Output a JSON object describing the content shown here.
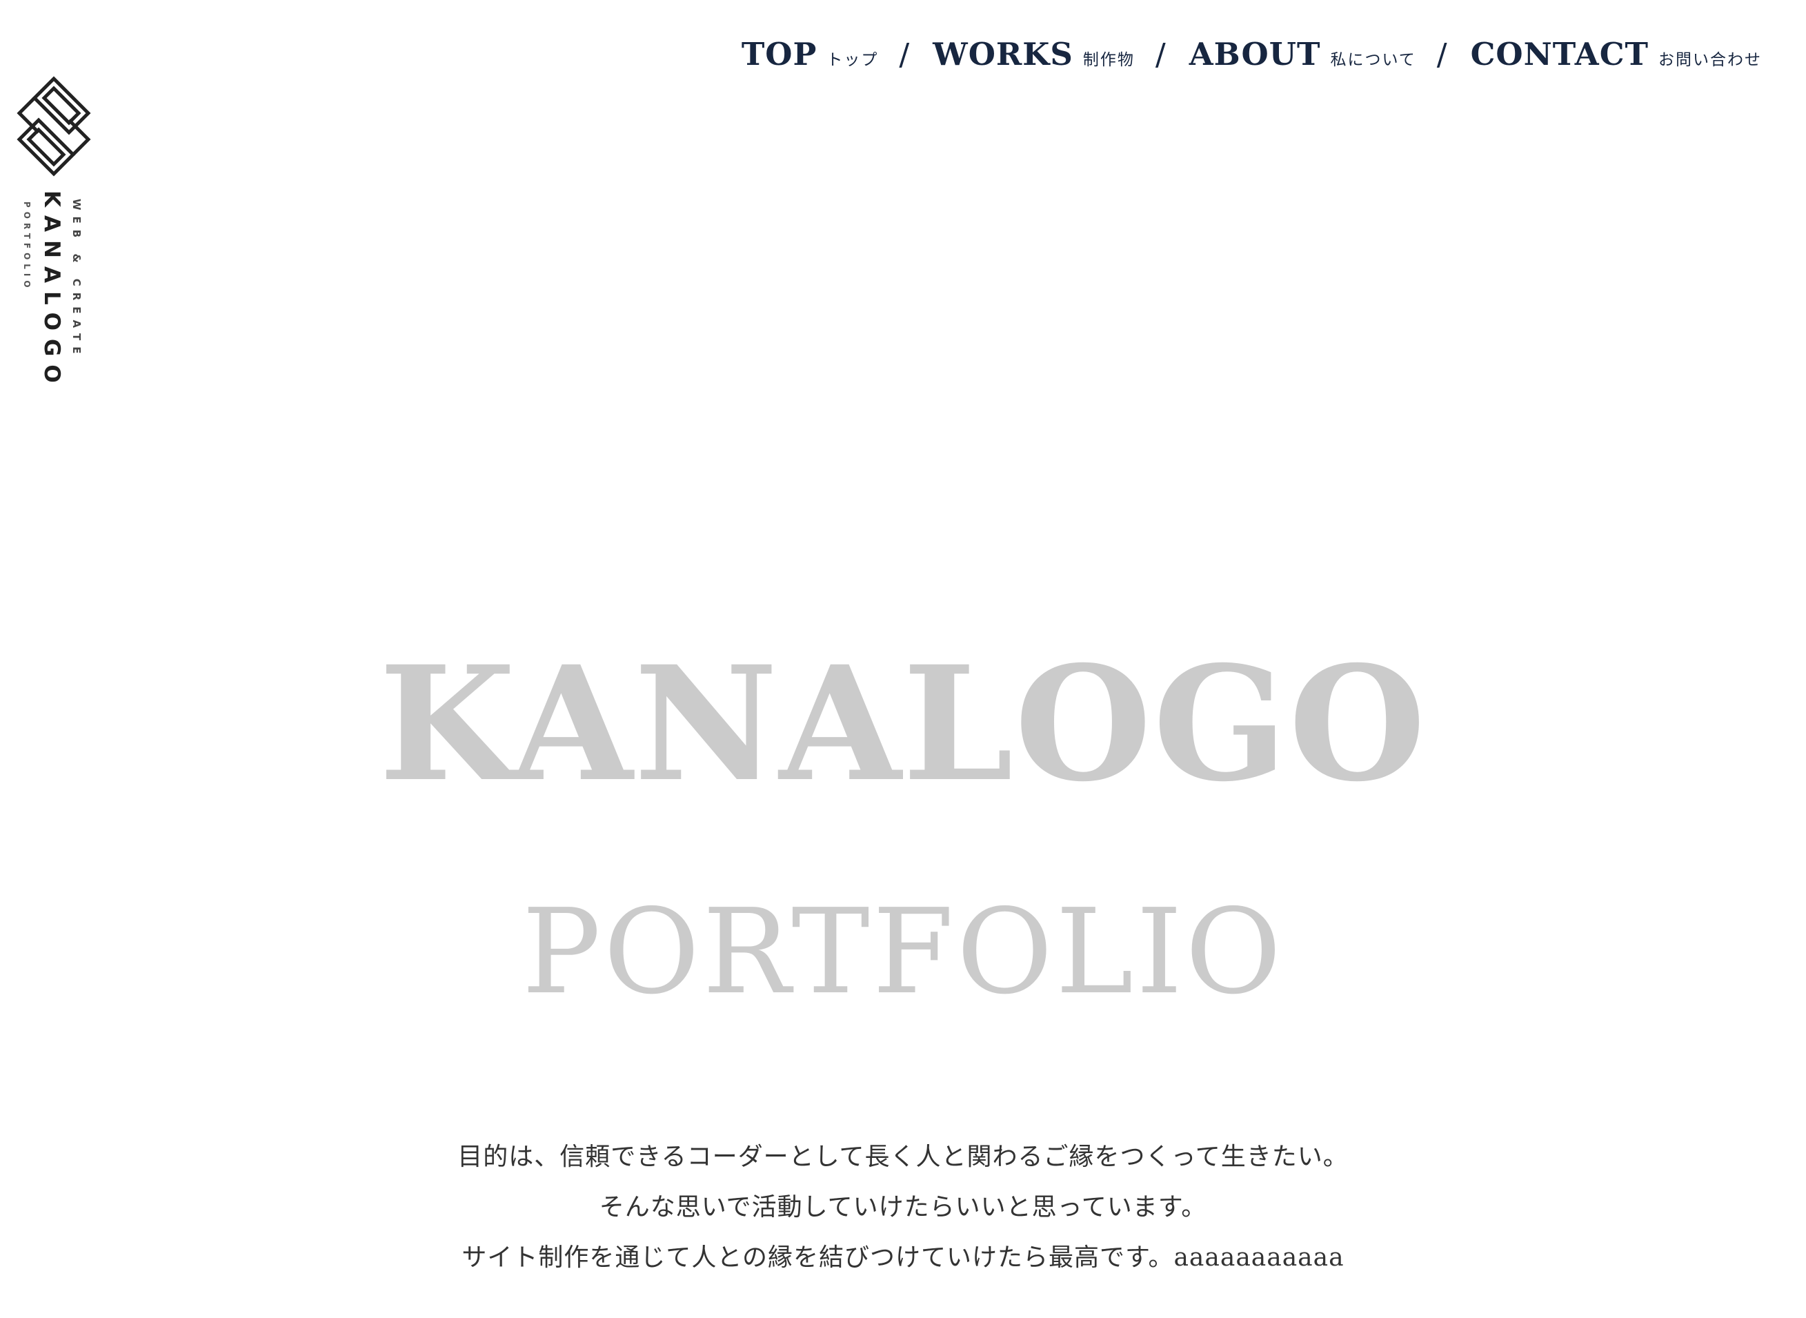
{
  "logo": {
    "tagline": "WEB & CREATE",
    "brand": "KANALOGO",
    "sub": "PORTFOLIO",
    "mark_icon": "interlocking-s-diamond-icon"
  },
  "nav": {
    "items": [
      {
        "en": "TOP",
        "ja": "トップ"
      },
      {
        "en": "WORKS",
        "ja": "制作物"
      },
      {
        "en": "ABOUT",
        "ja": "私について"
      },
      {
        "en": "CONTACT",
        "ja": "お問い合わせ"
      }
    ],
    "separator": "/"
  },
  "hero": {
    "title": "KANALOGO",
    "subtitle": "PORTFOLIO"
  },
  "message": {
    "lines": [
      "目的は、信頼できるコーダーとして長く人と関わるご縁をつくって生きたい。",
      "そんな思いで活動していけたらいいと思っています。",
      "サイト制作を通じて人との縁を結びつけていけたら最高です。aaaaaaaaaaa"
    ]
  },
  "colors": {
    "nav": "#172640",
    "hero_text": "#cbcbcb",
    "body_text": "#333333",
    "logo": "#1f1f1f",
    "background": "#ffffff"
  }
}
